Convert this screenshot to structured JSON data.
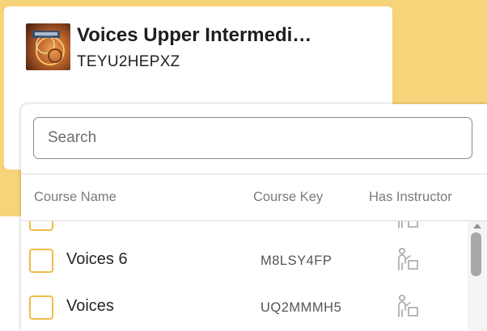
{
  "course": {
    "title": "Voices Upper Intermedi…",
    "code": "TEYU2HEPXZ",
    "thumbnail_icon": "book-cover-icon"
  },
  "search": {
    "placeholder": "Search",
    "value": ""
  },
  "table": {
    "headers": {
      "course_name": "Course Name",
      "course_key": "Course Key",
      "has_instructor": "Has Instructor"
    },
    "rows": [
      {
        "name": "",
        "key": "",
        "has_instructor": true
      },
      {
        "name": "Voices 6",
        "key": "M8LSY4FP",
        "has_instructor": true
      },
      {
        "name": "Voices",
        "key": "UQ2MMMH5",
        "has_instructor": true
      }
    ]
  },
  "colors": {
    "accent_yellow": "#f6d479",
    "checkbox_border": "#f0bc4a",
    "instructor_icon": "#a7a7a7"
  },
  "icons": {
    "instructor": "instructor-at-board-icon"
  }
}
